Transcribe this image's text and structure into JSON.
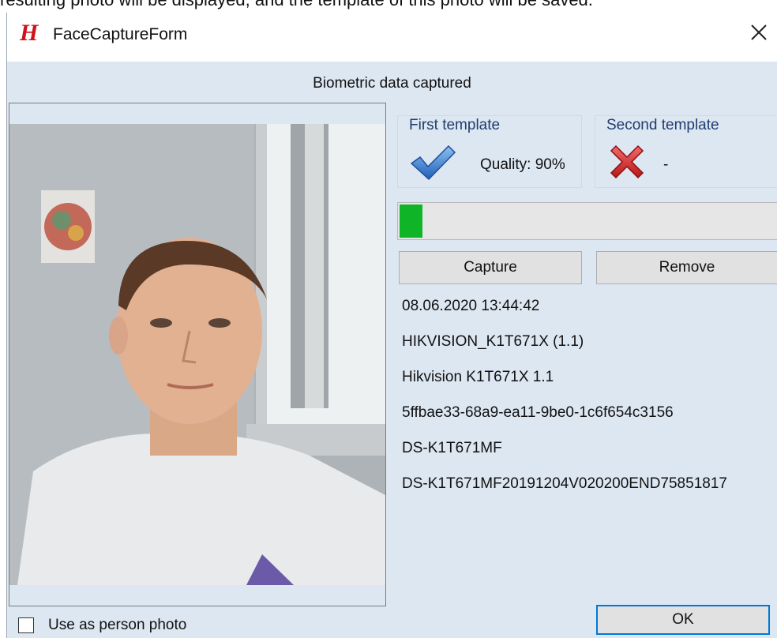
{
  "page": {
    "caption": "resulting photo will be displayed, and the template of this photo will be saved."
  },
  "window": {
    "logo": "H",
    "title": "FaceCaptureForm",
    "close_symbol": "×"
  },
  "status": "Biometric data captured",
  "templates": {
    "first": {
      "title": "First template",
      "icon": "checkmark-icon",
      "quality": "Quality: 90%"
    },
    "second": {
      "title": "Second template",
      "icon": "red-x-icon",
      "quality": "-"
    }
  },
  "progress": {
    "fraction": 0.06,
    "color": "#0fb427"
  },
  "buttons": {
    "capture": "Capture",
    "remove": "Remove",
    "ok": "OK"
  },
  "device_info": [
    "08.06.2020 13:44:42",
    "HIKVISION_K1T671X (1.1)",
    "Hikvision K1T671X 1.1",
    "5ffbae33-68a9-ea11-9be0-1c6f654c3156",
    "DS-K1T671MF",
    "DS-K1T671MF20191204V020200END75851817"
  ],
  "person_photo": {
    "label": "Use as person photo",
    "checked": false
  },
  "colors": {
    "logo": "#d0121b",
    "window_bg": "#dde7f2",
    "ok_border": "#0078d7"
  }
}
